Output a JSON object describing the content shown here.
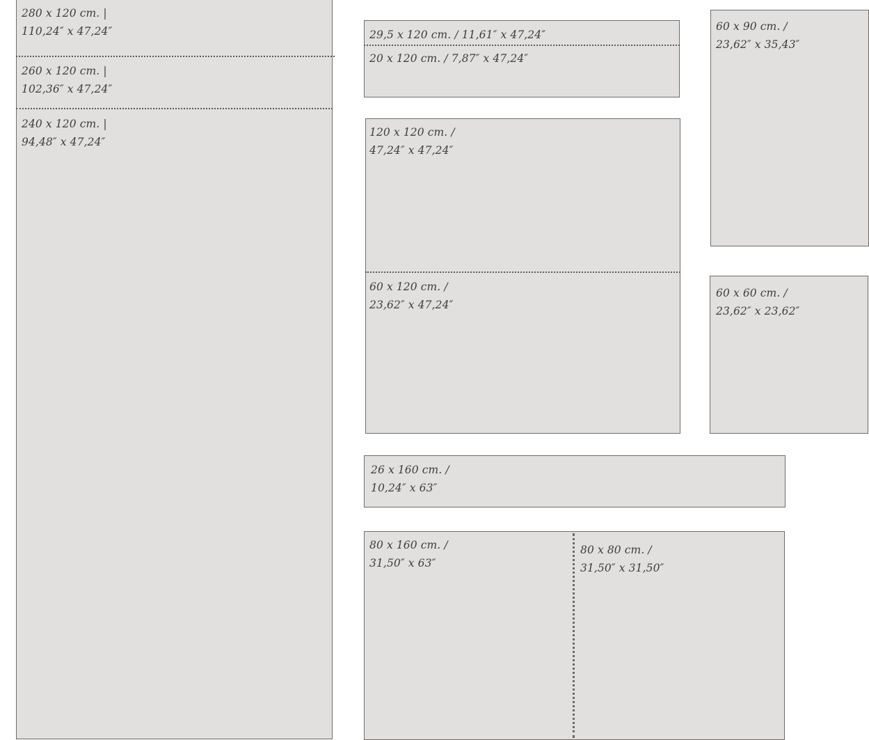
{
  "panels": {
    "tall_left": {
      "size_280": {
        "line1": "280 x 120 cm. |",
        "line2": "110,24″ x 47,24″"
      },
      "size_260": {
        "line1": "260 x 120 cm. |",
        "line2": "102,36″ x 47,24″"
      },
      "size_240": {
        "line1": "240 x 120 cm. |",
        "line2": "94,48″ x 47,24″"
      }
    },
    "narrow_top": {
      "size_29_5": {
        "line1": "29,5 x 120 cm. / 11,61″ x 47,24″"
      },
      "size_20": {
        "line1": "20 x 120 cm. / 7,87″ x 47,24″"
      }
    },
    "square_mid": {
      "size_120": {
        "line1": "120 x 120 cm. /",
        "line2": "47,24″ x 47,24″"
      },
      "size_60x120": {
        "line1": "60 x 120 cm. /",
        "line2": "23,62″ x 47,24″"
      }
    },
    "right_tall": {
      "size_60x90": {
        "line1": "60 x 90 cm. /",
        "line2": "23,62″ x 35,43″"
      }
    },
    "right_small": {
      "size_60x60": {
        "line1": "60 x 60 cm. /",
        "line2": "23,62″ x 23,62″"
      }
    },
    "strip": {
      "size_26x160": {
        "line1": "26 x 160 cm. /",
        "line2": "10,24″ x 63″"
      }
    },
    "bottom": {
      "size_80x160": {
        "line1": "80 x 160 cm. /",
        "line2": "31,50″ x 63″"
      },
      "size_80x80": {
        "line1": "80 x 80 cm. /",
        "line2": "31,50″ x 31,50″"
      }
    }
  }
}
